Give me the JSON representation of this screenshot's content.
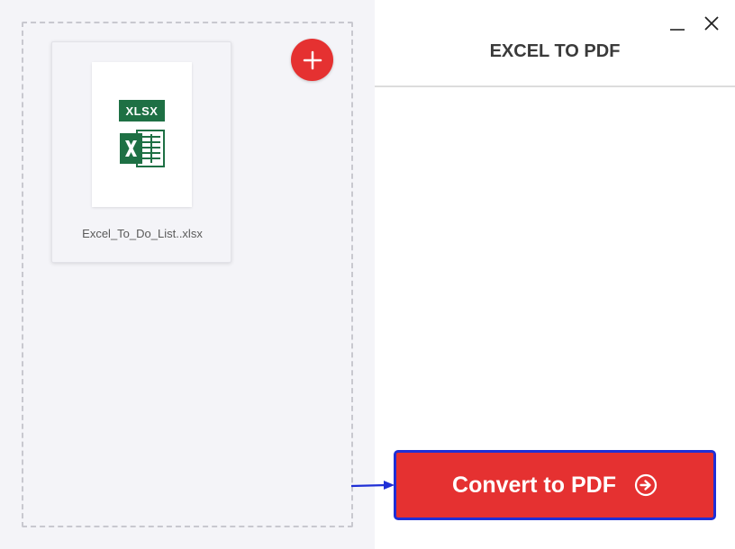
{
  "window": {
    "title": "EXCEL TO PDF"
  },
  "file": {
    "type_badge": "XLSX",
    "name": "Excel_To_Do_List..xlsx"
  },
  "actions": {
    "convert_label": "Convert to PDF"
  },
  "icons": {
    "add": "plus-icon",
    "minimize": "minimize-icon",
    "close": "close-icon",
    "convert": "arrow-right-circle-icon",
    "file": "excel-file-icon"
  },
  "colors": {
    "accent_red": "#e53131",
    "excel_green": "#1e7044",
    "highlight_blue": "#1f2fd6",
    "left_panel_bg": "#f4f4f8"
  }
}
